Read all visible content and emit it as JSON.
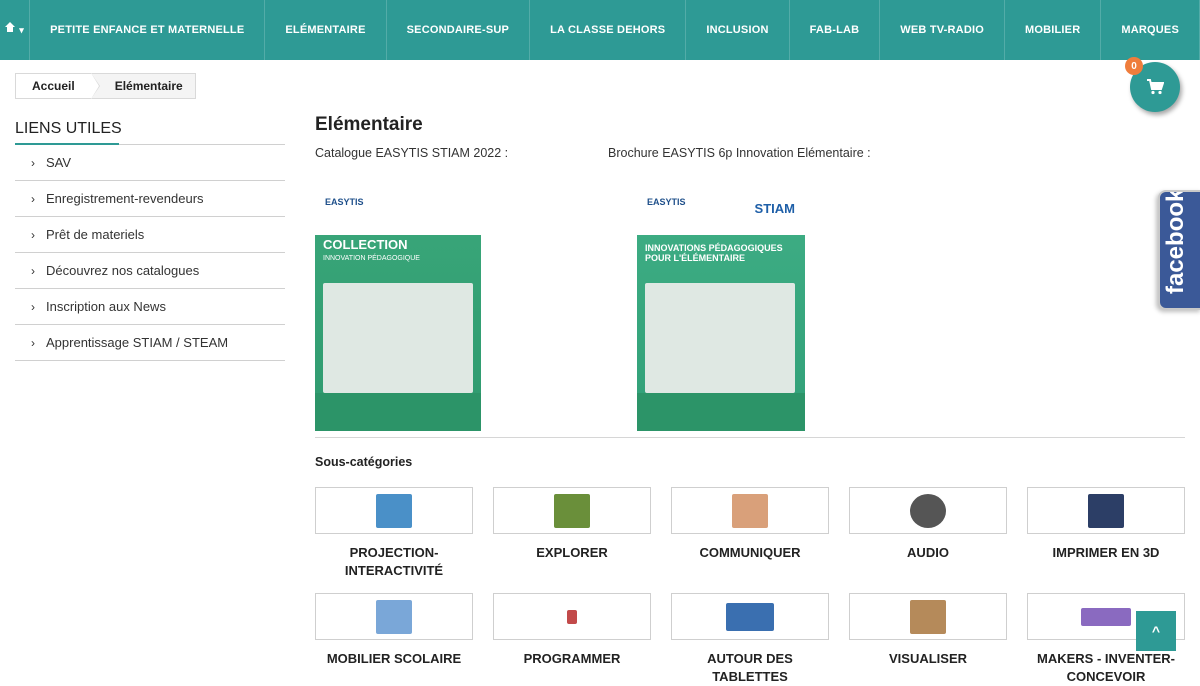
{
  "nav": {
    "home_icon": "home-icon",
    "home_caret": "▾",
    "items": [
      {
        "label": "PETITE ENFANCE ET MATERNELLE"
      },
      {
        "label": "ELÉMENTAIRE"
      },
      {
        "label": "SECONDAIRE-SUP"
      },
      {
        "label": "LA CLASSE DEHORS"
      },
      {
        "label": "INCLUSION"
      },
      {
        "label": "FAB-LAB"
      },
      {
        "label": "WEB TV-RADIO"
      },
      {
        "label": "MOBILIER"
      },
      {
        "label": "MARQUES"
      }
    ]
  },
  "breadcrumb": {
    "home": "Accueil",
    "current": "Elémentaire"
  },
  "cart": {
    "count": "0",
    "icon": "cart-icon"
  },
  "sidebar": {
    "title": "LIENS UTILES",
    "items": [
      {
        "label": "SAV"
      },
      {
        "label": "Enregistrement-revendeurs"
      },
      {
        "label": "Prêt de materiels"
      },
      {
        "label": "Découvrez nos catalogues"
      },
      {
        "label": "Inscription aux News"
      },
      {
        "label": "Apprentissage STIAM / STEAM"
      }
    ]
  },
  "main": {
    "title": "Elémentaire",
    "catalog1_label": "Catalogue EASYTIS STIAM 2022 :",
    "catalog2_label": "Brochure EASYTIS 6p Innovation Elémentaire :",
    "cover1": {
      "logo": "EASYTIS",
      "title": "COLLECTION",
      "subtitle": "INNOVATION PÉDAGOGIQUE"
    },
    "cover2": {
      "logo": "EASYTIS",
      "logo_right": "STIAM",
      "title": "INNOVATIONS PÉDAGOGIQUES POUR L'ÉLÉMENTAIRE"
    },
    "subcategories_title": "Sous-catégories",
    "subcategories": [
      {
        "label": "PROJECTION-INTERACTIVITÉ",
        "color": "#4a90c8"
      },
      {
        "label": "EXPLORER",
        "color": "#6a8f3a"
      },
      {
        "label": "COMMUNIQUER",
        "color": "#d9a07a"
      },
      {
        "label": "AUDIO",
        "color": "#555555"
      },
      {
        "label": "IMPRIMER EN 3D",
        "color": "#2c3e66"
      },
      {
        "label": "MOBILIER SCOLAIRE",
        "color": "#7aa7d8"
      },
      {
        "label": "PROGRAMMER",
        "color": "#c24a4a"
      },
      {
        "label": "AUTOUR DES TABLETTES",
        "color": "#3a6fb0"
      },
      {
        "label": "VISUALISER",
        "color": "#b58a5a"
      },
      {
        "label": "MAKERS - INVENTER-CONCEVOIR",
        "color": "#8a6ac0"
      }
    ]
  },
  "facebook": {
    "label": "facebook"
  },
  "back_to_top": {
    "icon": "chevron-up-icon",
    "symbol": "^"
  }
}
